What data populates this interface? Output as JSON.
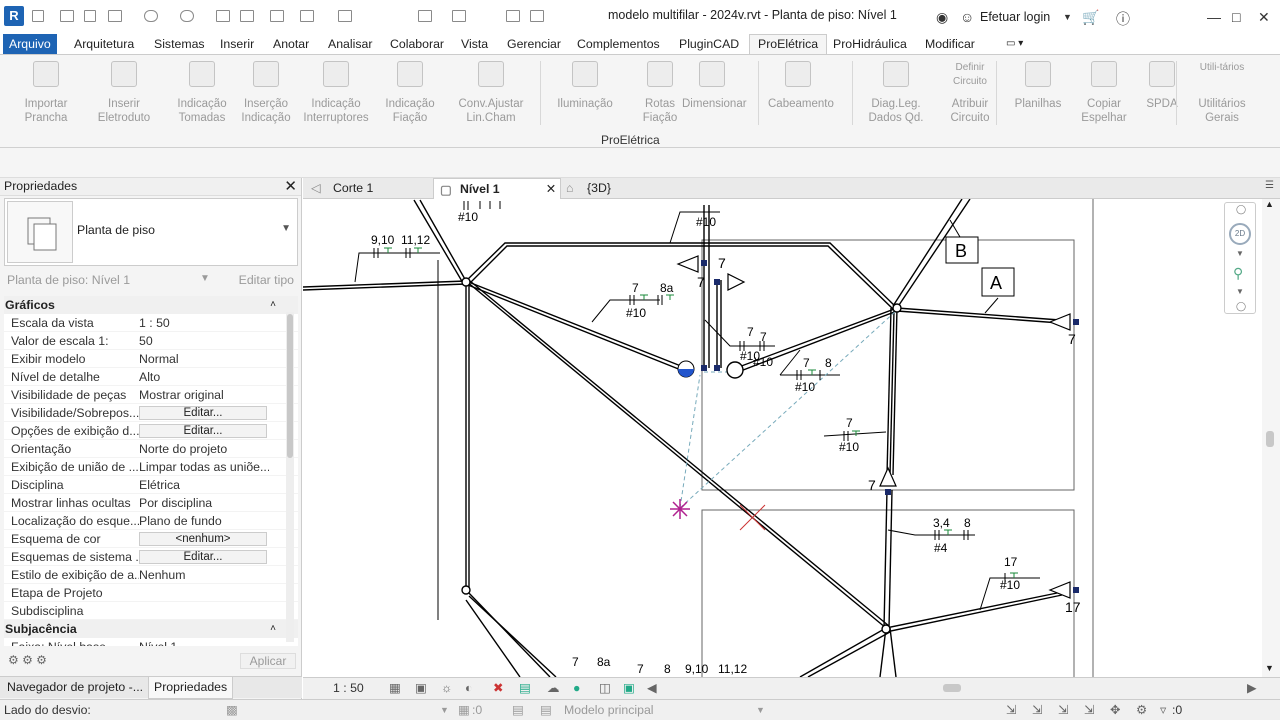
{
  "title_bar": {
    "title": "modelo multifilar - 2024v.rvt - Planta de piso: Nível 1",
    "login": "Efetuar login",
    "logo": "R"
  },
  "menu": {
    "items": [
      "Arquivo",
      "Arquitetura",
      "Sistemas",
      "Inserir",
      "Anotar",
      "Analisar",
      "Colaborar",
      "Vista",
      "Gerenciar",
      "Complementos",
      "PluginCAD",
      "ProElétrica",
      "ProHidráulica",
      "Modificar"
    ]
  },
  "ribbon": {
    "panel_name": "ProElétrica",
    "buttons": [
      {
        "l1": "Importar",
        "l2": "Prancha",
        "icon": "import-sheet-icon"
      },
      {
        "l1": "Inserir",
        "l2": "Eletroduto",
        "icon": "conduit-icon"
      },
      {
        "l1": "Indicação",
        "l2": "Tomadas",
        "icon": "outlet-icon"
      },
      {
        "l1": "Inserção",
        "l2": "Indicação",
        "icon": "insert-indication-icon"
      },
      {
        "l1": "Indicação",
        "l2": "Interruptores",
        "icon": "switch-icon"
      },
      {
        "l1": "Indicação",
        "l2": "Fiação",
        "icon": "wiring-icon"
      },
      {
        "l1": "Conv.Ajustar",
        "l2": "Lin.Cham",
        "icon": "adjust-line-icon"
      },
      {
        "l1": "Iluminação",
        "l2": "",
        "icon": "lighting-icon"
      },
      {
        "l1": "Rotas",
        "l2": "Fiação",
        "icon": "routes-icon"
      },
      {
        "l1": "Dimensionar",
        "l2": "",
        "icon": "dimension-icon"
      },
      {
        "l1": "Cabeamento",
        "l2": "",
        "icon": "cabling-icon"
      },
      {
        "l1": "Diag.Leg.",
        "l2": "Dados Qd.",
        "icon": "diagram-icon"
      },
      {
        "l1": "Atribuir",
        "l2": "Circuito",
        "icon": "assign-circuit-icon",
        "top": "Definir Circuito"
      },
      {
        "l1": "Planilhas",
        "l2": "",
        "icon": "spreadsheet-icon"
      },
      {
        "l1": "Copiar",
        "l2": "Espelhar",
        "icon": "copy-mirror-icon"
      },
      {
        "l1": "SPDA",
        "l2": "",
        "icon": "spda-icon"
      },
      {
        "l1": "Utilitários",
        "l2": "Gerais",
        "icon": "utilities-icon",
        "top": "Utili-tários"
      }
    ]
  },
  "properties": {
    "title": "Propriedades",
    "type_name": "Planta de piso",
    "selector": "Planta de piso: Nível 1",
    "edit_type": "Editar tipo",
    "groups": [
      {
        "name": "Gráficos",
        "rows": [
          {
            "k": "Escala da vista",
            "v": "1 : 50"
          },
          {
            "k": "Valor de escala    1:",
            "v": "50"
          },
          {
            "k": "Exibir modelo",
            "v": "Normal"
          },
          {
            "k": "Nível de detalhe",
            "v": "Alto"
          },
          {
            "k": "Visibilidade de peças",
            "v": "Mostrar original"
          },
          {
            "k": "Visibilidade/Sobrepos...",
            "v": "Editar...",
            "btn": true
          },
          {
            "k": "Opções de exibição d...",
            "v": "Editar...",
            "btn": true
          },
          {
            "k": "Orientação",
            "v": "Norte do projeto"
          },
          {
            "k": "Exibição de união de ...",
            "v": "Limpar todas as uniõe..."
          },
          {
            "k": "Disciplina",
            "v": "Elétrica"
          },
          {
            "k": "Mostrar linhas ocultas",
            "v": "Por disciplina"
          },
          {
            "k": "Localização do esque...",
            "v": "Plano de fundo"
          },
          {
            "k": "Esquema de cor",
            "v": "<nenhum>",
            "btn": true
          },
          {
            "k": "Esquemas de sistema ...",
            "v": "Editar...",
            "btn": true
          },
          {
            "k": "Estilo de exibição de a...",
            "v": "Nenhum"
          },
          {
            "k": "Etapa de Projeto",
            "v": ""
          },
          {
            "k": "Subdisciplina",
            "v": ""
          }
        ]
      },
      {
        "name": "Subjacência",
        "rows": [
          {
            "k": "Faixa: Nível base",
            "v": "Nível 1"
          }
        ]
      }
    ],
    "apply": "Aplicar"
  },
  "bottom_tabs": [
    "Navegador de projeto -...",
    "Propriedades"
  ],
  "view_tabs": [
    "Corte 1",
    "Nível 1",
    "{3D}"
  ],
  "view_control": {
    "scale": "1 : 50"
  },
  "status": {
    "left": "Lado do desvio:",
    "filter": ":0",
    "model": "Modelo principal",
    "count": ":0",
    "count2": ":0"
  },
  "drawing": {
    "labels": {
      "l1": "#10",
      "l2": "9,10",
      "l3": "11,12",
      "l4": "#10",
      "l5": "7",
      "l6": "7",
      "l7": "7",
      "l8": "8a",
      "l9": "#10",
      "l10": "B",
      "l11": "A",
      "l12": "7",
      "l13": "7",
      "l14": "7",
      "l15": "#10",
      "l16": "#10",
      "l17": "7",
      "l18": "8",
      "l19": "#10",
      "l20": "7",
      "l21": "#10",
      "l22": "7",
      "l23": "3,4",
      "l24": "8",
      "l25": "#4",
      "l26": "17",
      "l27": "#10",
      "l28": "17",
      "l29": "7",
      "l30": "8a",
      "l31": "7",
      "l32": "8",
      "l33": "9,10",
      "l34": "11,12",
      "l35": "7"
    }
  }
}
